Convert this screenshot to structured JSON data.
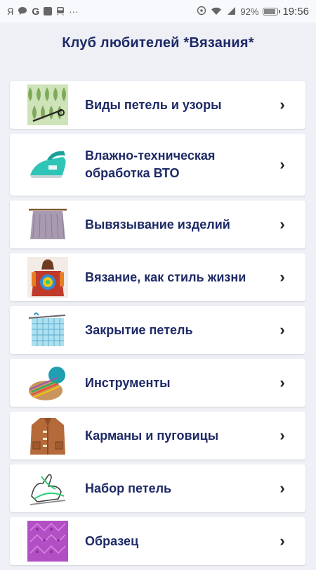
{
  "status_bar": {
    "time": "19:56",
    "battery_percent": "92%",
    "battery_level": 0.92,
    "icons": [
      "yandex-icon",
      "message-icon",
      "google-icon",
      "square-icon",
      "train-icon",
      "more-icon",
      "nfc-icon",
      "wifi-icon",
      "signal-icon",
      "battery-icon"
    ]
  },
  "header": {
    "title": "Клуб любителей *Вязания*"
  },
  "menu": {
    "chevron": "›",
    "items": [
      {
        "label": "Виды петель и узоры",
        "thumb": "knit-pattern-thumb"
      },
      {
        "label": "Влажно-техническая обработка ВТО",
        "thumb": "steam-iron-thumb"
      },
      {
        "label": "Вывязывание изделий",
        "thumb": "knitted-skirt-thumb"
      },
      {
        "label": "Вязание, как стиль жизни",
        "thumb": "crochet-top-thumb"
      },
      {
        "label": "Закрытие петель",
        "thumb": "binding-off-thumb"
      },
      {
        "label": "Инструменты",
        "thumb": "knitting-tools-thumb"
      },
      {
        "label": "Карманы и пуговицы",
        "thumb": "coat-with-buttons-thumb"
      },
      {
        "label": "Набор петель",
        "thumb": "cast-on-hand-thumb"
      },
      {
        "label": "Образец",
        "thumb": "lace-sample-thumb"
      }
    ]
  },
  "colors": {
    "title": "#1e2a66",
    "background": "#eef0f6",
    "card": "#ffffff"
  }
}
